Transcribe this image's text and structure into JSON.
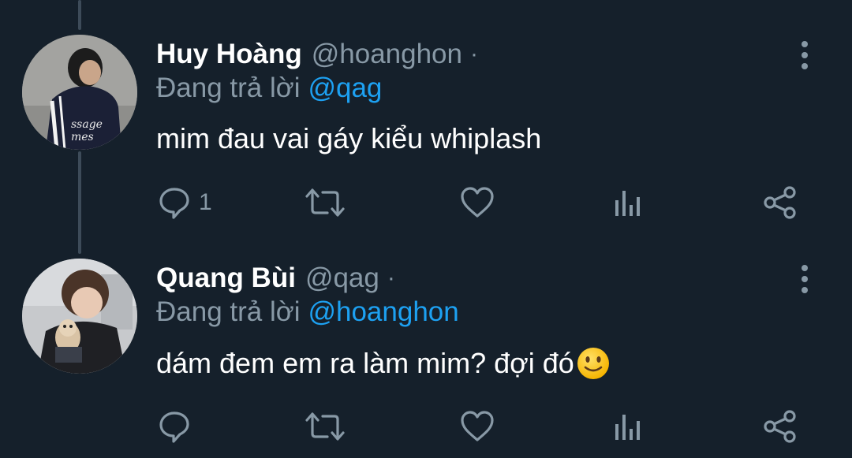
{
  "tweets": [
    {
      "display_name": "Huy Hoàng",
      "handle": "@hoanghon",
      "separator": "·",
      "reply_prefix": "Đang trả lời",
      "reply_to": "@qag",
      "text": "mim đau vai gáy kiểu whiplash",
      "reply_count": "1",
      "icons": [
        "reply-icon",
        "retweet-icon",
        "like-icon",
        "analytics-icon",
        "share-icon",
        "more-icon"
      ]
    },
    {
      "display_name": "Quang Bùi",
      "handle": "@qag",
      "separator": "·",
      "reply_prefix": "Đang trả lời",
      "reply_to": "@hoanghon",
      "text": "dám đem em ra làm mim? đợi đó",
      "emoji": "slightly-smiling-face",
      "reply_count": "",
      "icons": [
        "reply-icon",
        "retweet-icon",
        "like-icon",
        "analytics-icon",
        "share-icon",
        "more-icon"
      ]
    }
  ],
  "colors": {
    "background": "#15202b",
    "secondary_text": "#8899a6",
    "mention": "#1da1f2",
    "thread_line": "#3d4b59"
  }
}
